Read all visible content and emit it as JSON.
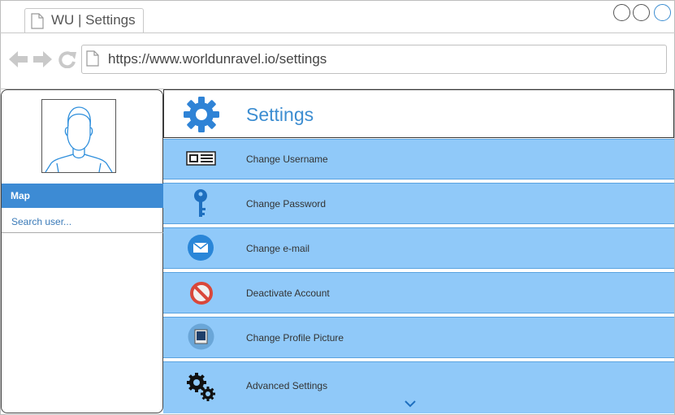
{
  "browser": {
    "tab_title": "WU | Settings",
    "url": "https://www.worldunravel.io/settings"
  },
  "sidebar": {
    "items": [
      {
        "label": "Map"
      },
      {
        "label": "Search user..."
      }
    ]
  },
  "main": {
    "title": "Settings",
    "rows": [
      {
        "label": "Change Username",
        "icon": "id-card-icon"
      },
      {
        "label": "Change Password",
        "icon": "key-icon"
      },
      {
        "label": "Change e-mail",
        "icon": "envelope-icon"
      },
      {
        "label": "Deactivate Account",
        "icon": "prohibited-icon"
      },
      {
        "label": "Change Profile Picture",
        "icon": "picture-icon"
      },
      {
        "label": "Advanced Settings",
        "icon": "gears-icon"
      }
    ]
  },
  "colors": {
    "accent": "#3d8bd4",
    "row_bg": "#90c9f9",
    "title": "#3c8dd1"
  }
}
